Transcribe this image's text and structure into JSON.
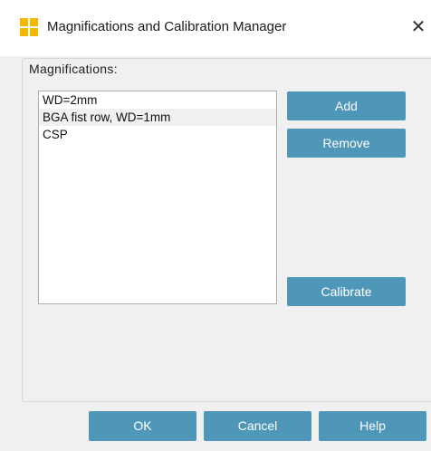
{
  "window": {
    "title": "Magnifications and Calibration Manager",
    "close_glyph": "✕",
    "icon": "app-grid-icon",
    "accent_color": "#4f97b8",
    "icon_color": "#f4b800"
  },
  "group": {
    "label": "Magnifications:"
  },
  "list": {
    "items": [
      {
        "label": "WD=2mm",
        "selected": false
      },
      {
        "label": "BGA fist row, WD=1mm",
        "selected": true
      },
      {
        "label": "CSP",
        "selected": false
      }
    ]
  },
  "buttons": {
    "add": "Add",
    "remove": "Remove",
    "calibrate": "Calibrate",
    "ok": "OK",
    "cancel": "Cancel",
    "help": "Help"
  }
}
